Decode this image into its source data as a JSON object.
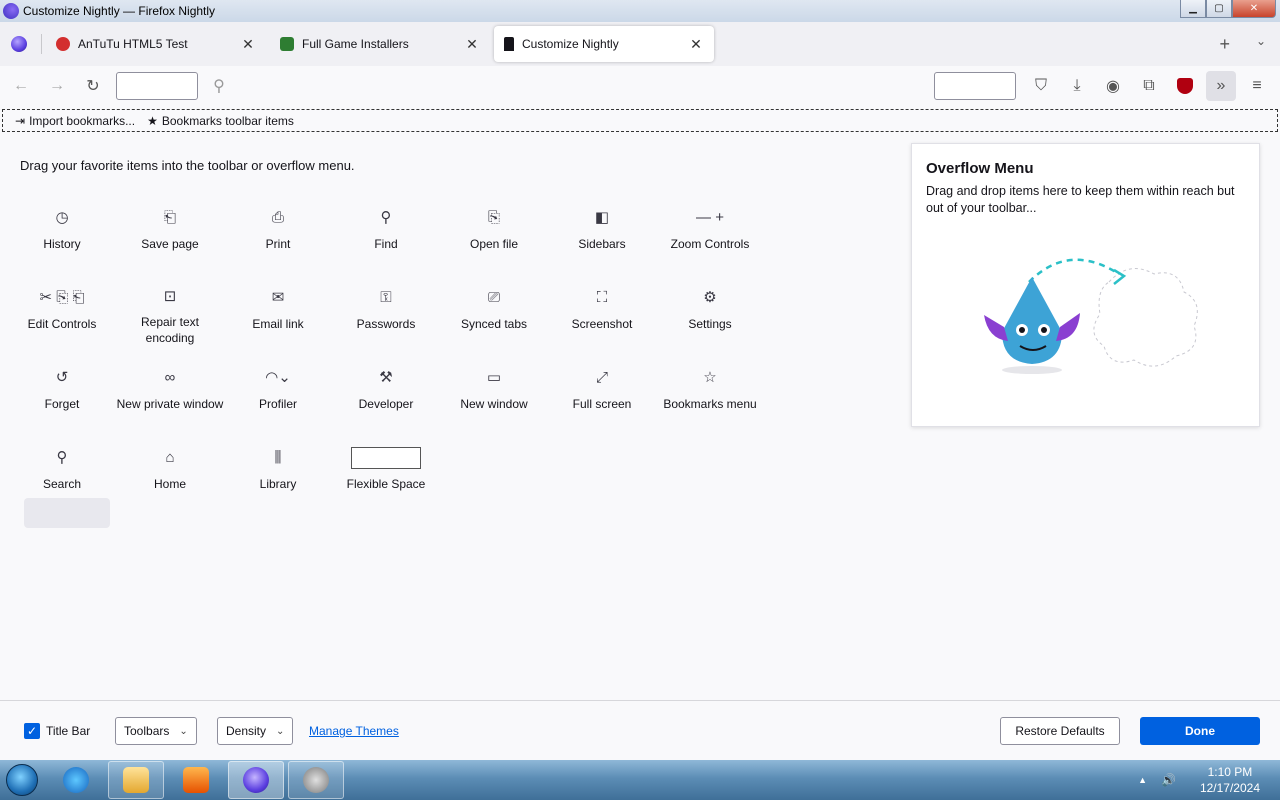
{
  "window": {
    "title": "Customize Nightly — Firefox Nightly",
    "minimize": "▁",
    "maximize": "▢",
    "close": "✕"
  },
  "tabs": [
    {
      "label": "AnTuTu HTML5 Test",
      "favicon_color": "#d32f2f",
      "close": "✕"
    },
    {
      "label": "Full Game Installers",
      "favicon_color": "#2e7d32",
      "close": "✕"
    },
    {
      "label": "Customize Nightly",
      "favicon_color": "#15141a",
      "close": "✕"
    }
  ],
  "tabstrip": {
    "new_tab": "+",
    "list_all": "⌄"
  },
  "navbar": {
    "back": "←",
    "forward": "→",
    "reload": "↻",
    "search_icon": "⚲",
    "pocket": "⛉",
    "downloads": "⤓",
    "account": "◉",
    "extensions": "⧉",
    "overflow": "»",
    "menu": "≡"
  },
  "bookmarks": {
    "import": "Import bookmarks...",
    "import_icon": "⇥",
    "toolbar_items": "Bookmarks toolbar items",
    "toolbar_icon": "★"
  },
  "customize": {
    "intro": "Drag your favorite items into the toolbar or overflow menu.",
    "palette": [
      {
        "label": "History",
        "icon": "◷",
        "name": "history"
      },
      {
        "label": "Save page",
        "icon": "⎗",
        "name": "save-page"
      },
      {
        "label": "Print",
        "icon": "⎙",
        "name": "print"
      },
      {
        "label": "Find",
        "icon": "⚲",
        "name": "find"
      },
      {
        "label": "Open file",
        "icon": "⎘",
        "name": "open-file"
      },
      {
        "label": "Sidebars",
        "icon": "◧",
        "name": "sidebars"
      },
      {
        "label": "Zoom Controls",
        "icon": "— +",
        "name": "zoom-controls"
      },
      {
        "label": "Edit Controls",
        "icon": "✂ ⎘ ⎗",
        "name": "edit-controls"
      },
      {
        "label": "Repair text encoding",
        "icon": "⊡",
        "name": "repair-text-encoding"
      },
      {
        "label": "Email link",
        "icon": "✉",
        "name": "email-link"
      },
      {
        "label": "Passwords",
        "icon": "⚿",
        "name": "passwords"
      },
      {
        "label": "Synced tabs",
        "icon": "⎚",
        "name": "synced-tabs"
      },
      {
        "label": "Screenshot",
        "icon": "⛶",
        "name": "screenshot"
      },
      {
        "label": "Settings",
        "icon": "⚙",
        "name": "settings"
      },
      {
        "label": "Forget",
        "icon": "↺",
        "name": "forget"
      },
      {
        "label": "New private window",
        "icon": "∞",
        "name": "new-private-window"
      },
      {
        "label": "Profiler",
        "icon": "◠⌄",
        "name": "profiler"
      },
      {
        "label": "Developer",
        "icon": "⚒",
        "name": "developer"
      },
      {
        "label": "New window",
        "icon": "▭",
        "name": "new-window"
      },
      {
        "label": "Full screen",
        "icon": "⤢",
        "name": "full-screen"
      },
      {
        "label": "Bookmarks menu",
        "icon": "☆",
        "name": "bookmarks-menu"
      },
      {
        "label": "Search",
        "icon": "⚲",
        "name": "search"
      },
      {
        "label": "Home",
        "icon": "⌂",
        "name": "home"
      },
      {
        "label": "Library",
        "icon": "⫼",
        "name": "library"
      },
      {
        "label": "Flexible Space",
        "icon": "",
        "name": "flexible-space"
      }
    ]
  },
  "overflow_menu": {
    "title": "Overflow Menu",
    "description": "Drag and drop items here to keep them within reach but out of your toolbar..."
  },
  "footer": {
    "title_bar_label": "Title Bar",
    "title_bar_checked": "✓",
    "toolbars": "Toolbars",
    "density": "Density",
    "caret": "⌄",
    "manage_themes": "Manage Themes",
    "restore_defaults": "Restore Defaults",
    "done": "Done"
  },
  "taskbar": {
    "time": "1:10 PM",
    "date": "12/17/2024",
    "tray_up": "▲",
    "volume": "🔊"
  },
  "colors": {
    "accent": "#0061e0",
    "ublock": "#b00010"
  }
}
